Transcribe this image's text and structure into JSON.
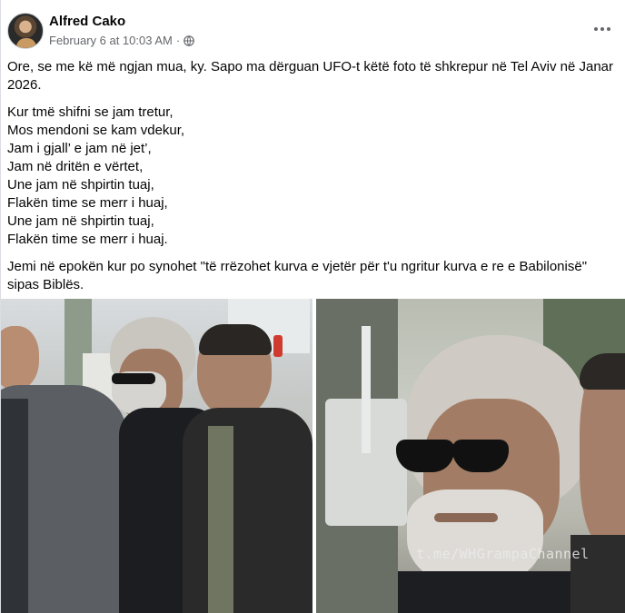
{
  "post": {
    "author": "Alfred Cako",
    "timestamp": "February 6 at 10:03 AM",
    "separator": "·",
    "privacy_icon": "globe-icon",
    "more_icon": "more-options-icon",
    "intro": "Ore, se me kë më ngjan mua, ky. Sapo ma dërguan UFO-t këtë foto të shkrepur në Tel Aviv në Janar 2026.",
    "poem": [
      "Kur tmë shifni se jam tretur,",
      "Mos mendoni se kam vdekur,",
      "Jam i gjall’ e jam në jet’,",
      "Jam në dritën e vërtet,",
      "Une jam në shpirtin tuaj,",
      "Flakën time se merr i huaj,",
      "Une jam në shpirtin tuaj,",
      "Flakën time se merr i huaj."
    ],
    "closing": "Jemi në epokën kur po synohet \"të rrëzohet kurva e vjetër për t'u ngritur kurva e re e Babilonisë\" sipas Biblës."
  },
  "photos": {
    "watermark": "t.me/WHGrampaChannel"
  }
}
